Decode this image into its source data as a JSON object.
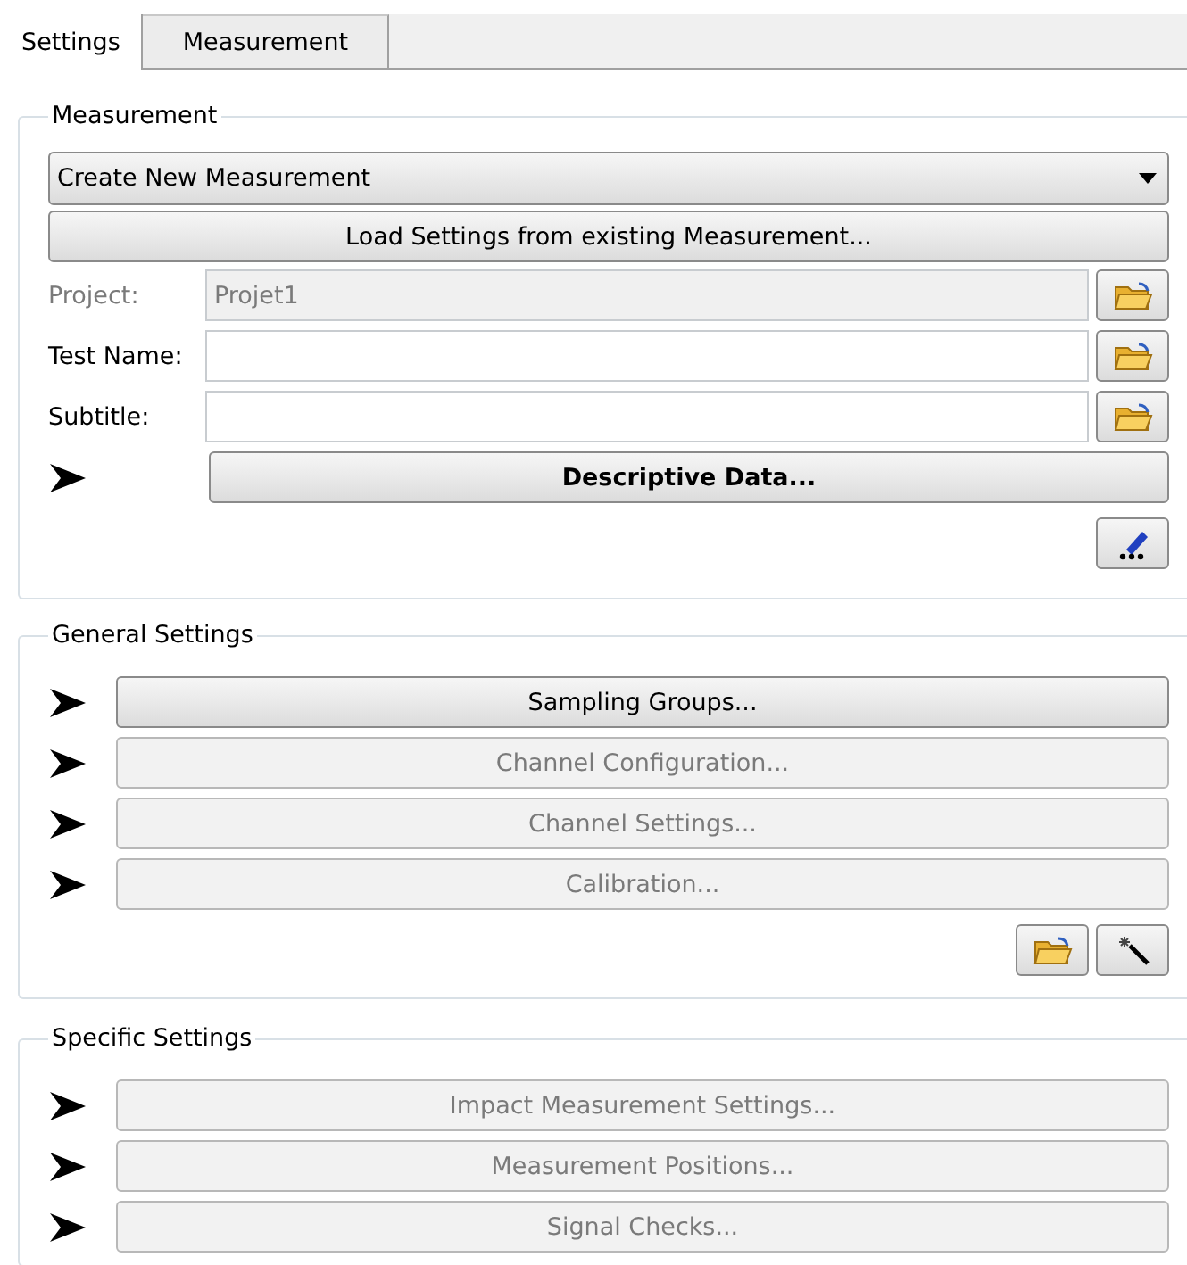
{
  "tabs": [
    {
      "label": "Settings",
      "selected": true
    },
    {
      "label": "Measurement",
      "selected": false
    }
  ],
  "measurement": {
    "title": "Measurement",
    "mode": "Create New Measurement",
    "load_button": "Load Settings from existing Measurement...",
    "fields": [
      {
        "label": "Project:",
        "value": "Projet1",
        "disabled": true
      },
      {
        "label": "Test Name:",
        "disabled": false
      },
      {
        "label": "Subtitle:",
        "disabled": false
      }
    ],
    "descriptive_button": "Descriptive Data..."
  },
  "general_settings": {
    "title": "General Settings",
    "buttons": [
      {
        "label": "Sampling Groups...",
        "disabled": false
      },
      {
        "label": "Channel Configuration...",
        "disabled": true
      },
      {
        "label": "Channel Settings...",
        "disabled": true
      },
      {
        "label": "Calibration...",
        "disabled": true
      }
    ]
  },
  "specific_settings": {
    "title": "Specific Settings",
    "buttons": [
      {
        "label": "Impact Measurement Settings...",
        "disabled": true
      },
      {
        "label": "Measurement Positions...",
        "disabled": true
      },
      {
        "label": "Signal Checks...",
        "disabled": true
      }
    ]
  }
}
